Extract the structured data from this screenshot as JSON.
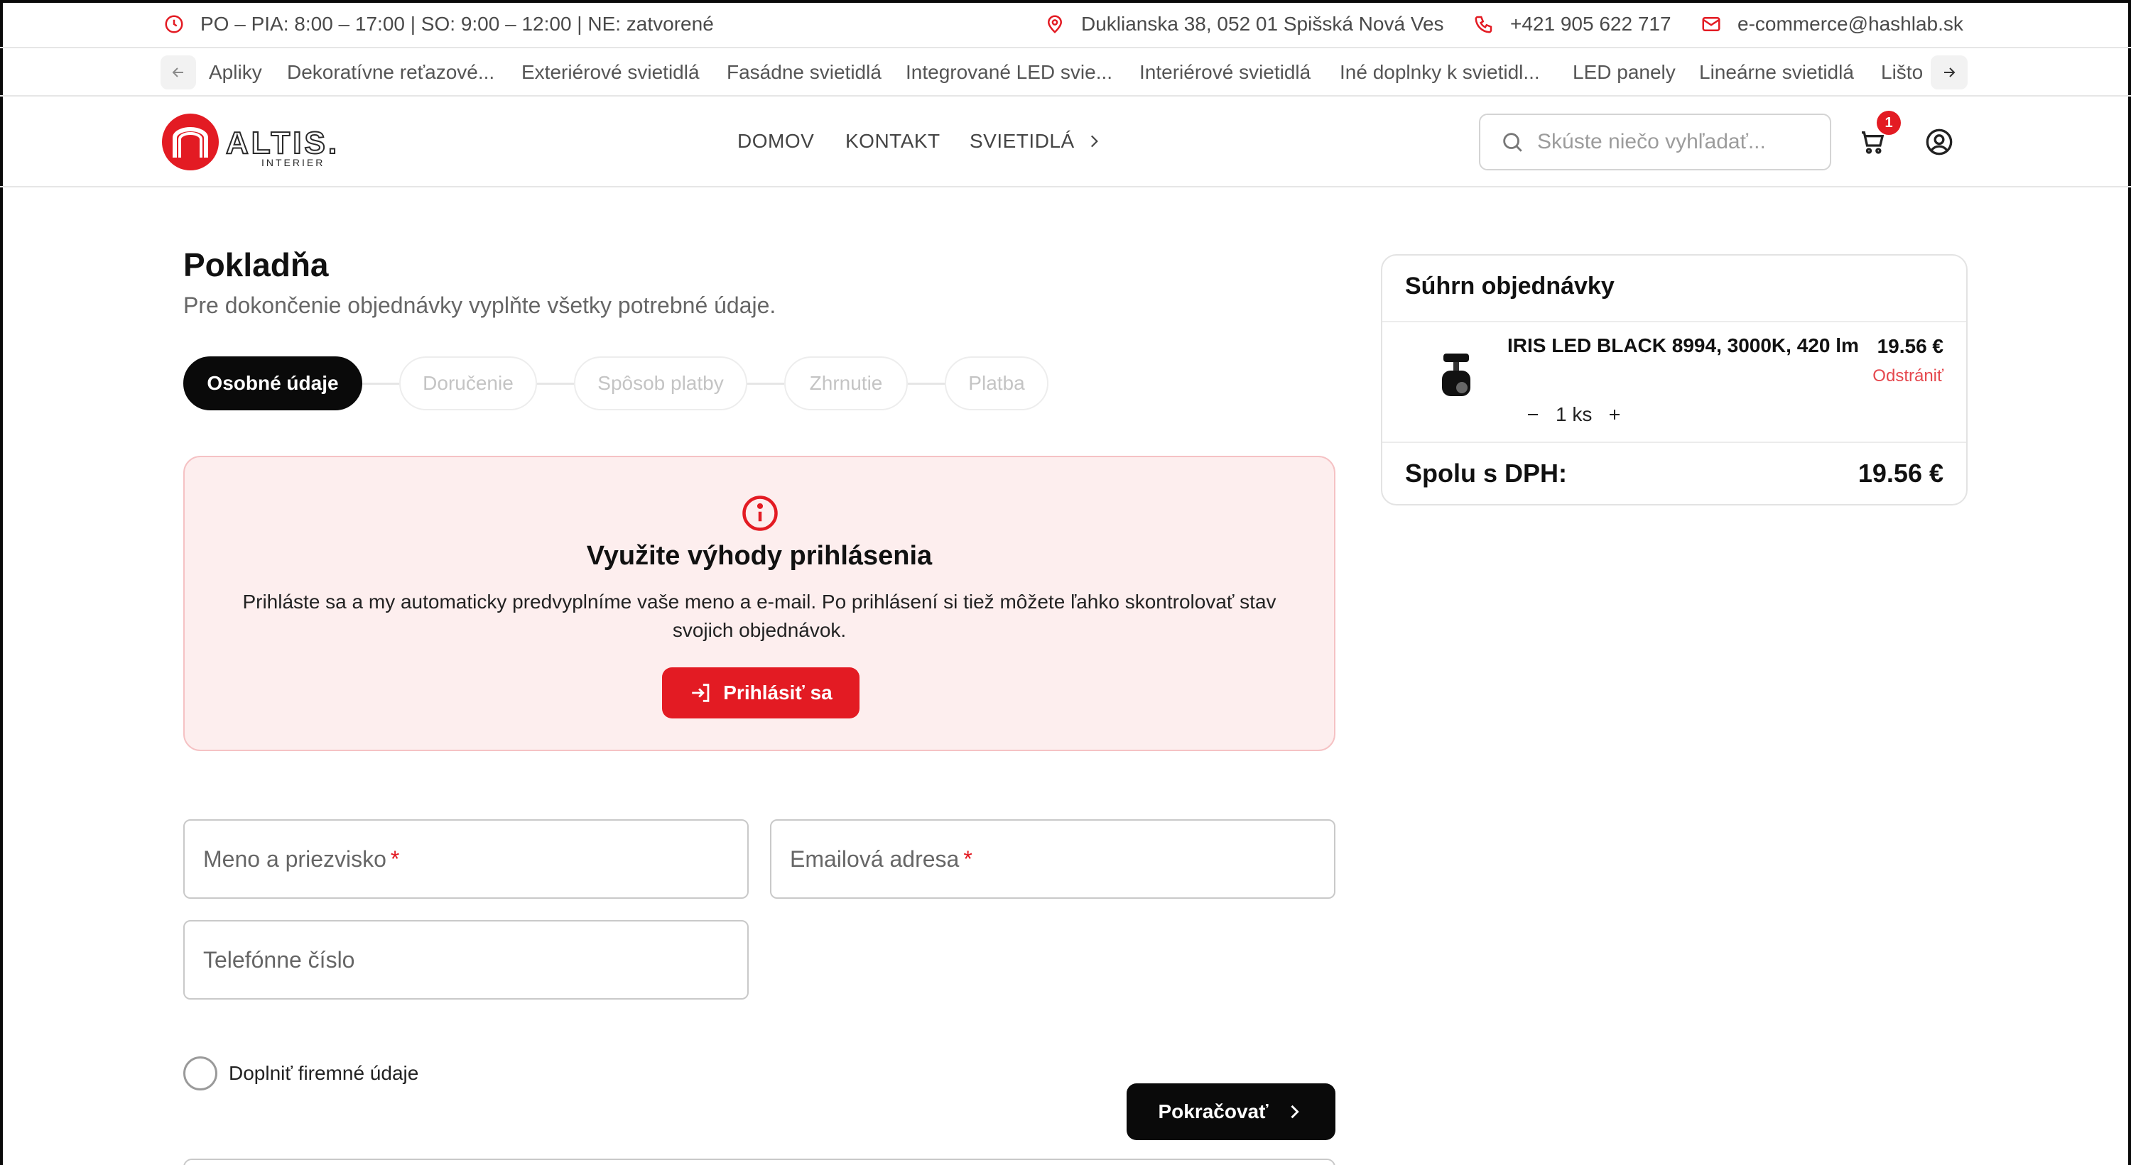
{
  "topbar": {
    "hours": "PO – PIA: 8:00 – 17:00 | SO: 9:00 – 12:00 | NE: zatvorené",
    "address": "Duklianska 38, 052 01 Spišská Nová Ves",
    "phone": "+421 905 622 717",
    "email": "e-commerce@hashlab.sk"
  },
  "categories": [
    "Apliky",
    "Dekoratívne reťazové...",
    "Exteriérové svietidlá",
    "Fasádne svietidlá",
    "Integrované LED svie...",
    "Interiérové svietidlá",
    "Iné doplnky k svietidl...",
    "LED panely",
    "Lineárne svietidlá",
    "Lišto"
  ],
  "header": {
    "logo_text": "ALTIS.",
    "logo_sub": "INTERIER",
    "nav": [
      "DOMOV",
      "KONTAKT",
      "SVIETIDLÁ"
    ],
    "search_placeholder": "Skúste niečo vyhľadať...",
    "cart_count": "1"
  },
  "checkout": {
    "title": "Pokladňa",
    "subtitle": "Pre dokončenie objednávky vyplňte všetky potrebné údaje.",
    "steps": [
      "Osobné údaje",
      "Doručenie",
      "Spôsob platby",
      "Zhrnutie",
      "Platba"
    ],
    "active_step": 0,
    "promo": {
      "title": "Využite výhody prihlásenia",
      "text": "Prihláste sa a my automaticky predvyplníme vaše meno a e-mail. Po prihlásení si tiež môžete ľahko skontrolovať stav svojich objednávok.",
      "button": "Prihlásiť sa"
    },
    "fields": {
      "name": "Meno a priezvisko",
      "email": "Emailová adresa",
      "phone": "Telefónne číslo",
      "required_mark": "*"
    },
    "company_checkbox": "Doplniť firemné údaje",
    "continue_button": "Pokračovať"
  },
  "summary": {
    "title": "Súhrn objednávky",
    "item": {
      "name": "IRIS LED BLACK 8994, 3000K, 420 lm",
      "price": "19.56 €",
      "remove": "Odstrániť",
      "quantity": "1 ks"
    },
    "total_label": "Spolu s DPH:",
    "total_value": "19.56 €"
  },
  "colors": {
    "brand_red": "#e31b23",
    "dark": "#0a0a0a",
    "promo_bg": "#fdeeee"
  }
}
